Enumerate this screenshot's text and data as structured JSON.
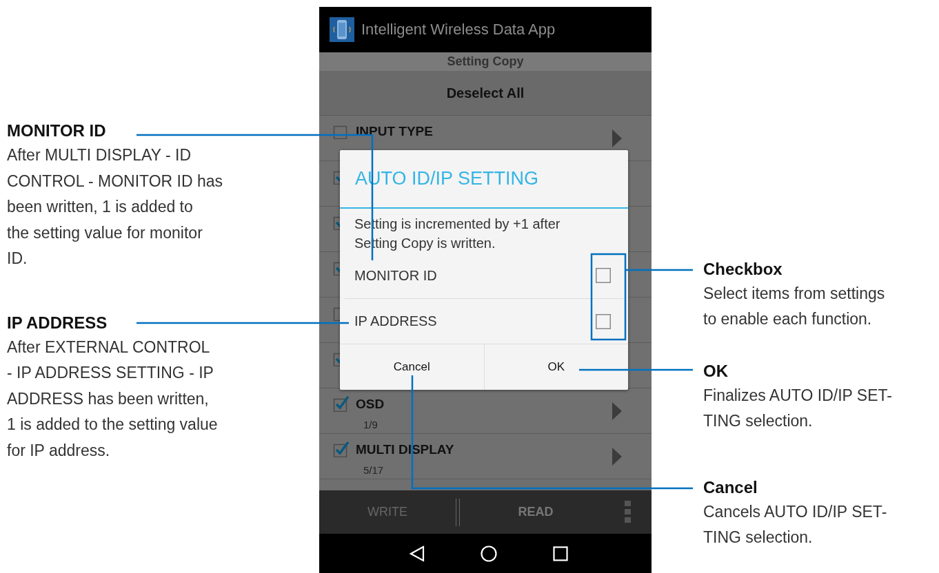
{
  "annotations_left": [
    {
      "title": "MONITOR ID",
      "text": "After MULTI DISPLAY - ID\nCONTROL - MONITOR ID has\nbeen written, 1 is added to\nthe setting value for monitor\nID."
    },
    {
      "title": "IP ADDRESS",
      "text": "After EXTERNAL CONTROL\n- IP ADDRESS SETTING - IP\nADDRESS has been written,\n1 is added to the setting value\nfor IP address."
    }
  ],
  "phone": {
    "app_title": "Intelligent Wireless Data App",
    "header": "Setting Copy",
    "deselect_button": "Deselect All",
    "rows": [
      {
        "checked": false,
        "label": "INPUT TYPE"
      },
      {
        "checked": true
      },
      {
        "checked": true
      },
      {
        "checked": true
      },
      {
        "checked": false
      },
      {
        "checked": true
      },
      {
        "checked": true,
        "label": "OSD",
        "count": "1/9"
      },
      {
        "checked": true,
        "label": "MULTI DISPLAY",
        "count": "5/17"
      }
    ],
    "dialog": {
      "title": "AUTO ID/IP SETTING",
      "message": "Setting is incremented by +1 after\nSetting Copy is written.",
      "options": [
        {
          "label": "MONITOR ID",
          "checked": false
        },
        {
          "label": "IP ADDRESS",
          "checked": false
        }
      ],
      "buttons": [
        "Cancel",
        "OK"
      ]
    },
    "bottom_bar": {
      "write_button": "WRITE",
      "read_button": "READ"
    }
  },
  "annotations_right": [
    {
      "title": "Checkbox",
      "text": "Select items from settings\nto enable each function."
    },
    {
      "title": "OK",
      "text": "Finalizes AUTO ID/IP SET-\nTING selection."
    },
    {
      "title": "Cancel",
      "text": "Cancels AUTO ID/IP SET-\nTING selection."
    }
  ]
}
